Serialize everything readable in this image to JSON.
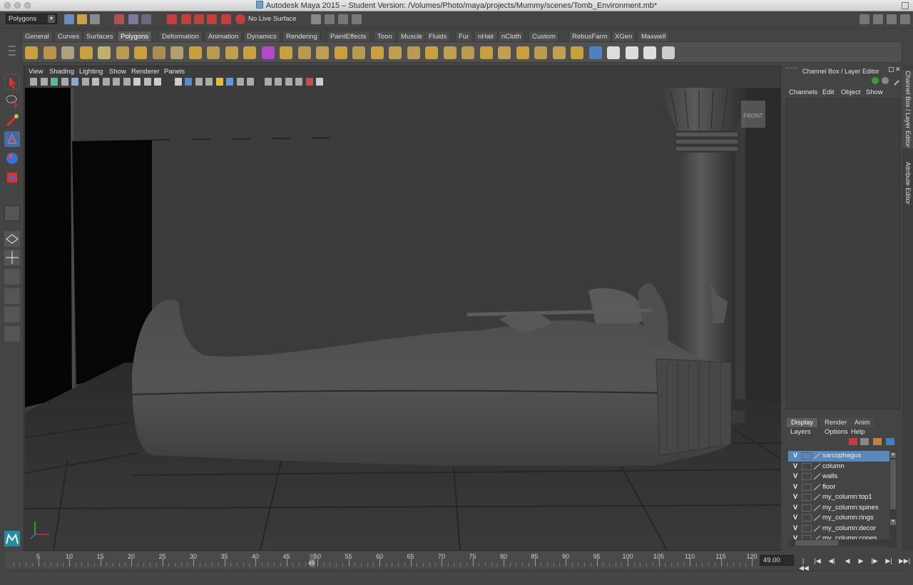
{
  "window": {
    "title": "Autodesk Maya 2015 – Student Version: /Volumes/Photo/maya/projects/Mummy/scenes/Tomb_Environment.mb*"
  },
  "status_line": {
    "menu_set": "Polygons",
    "live_surface": "No Live Surface"
  },
  "shelf_tabs": [
    "General",
    "Curves",
    "Surfaces",
    "Polygons",
    "Deformation",
    "Animation",
    "Dynamics",
    "Rendering",
    "PaintEffects",
    "Toon",
    "Muscle",
    "Fluids",
    "Fur",
    "nHair",
    "nCloth",
    "Custom",
    "RebusFarm",
    "XGen",
    "Maxwell"
  ],
  "shelf_active_tab": "Polygons",
  "viewport": {
    "menu": [
      "View",
      "Shading",
      "Lighting",
      "Show",
      "Renderer",
      "Panels"
    ],
    "view_cube_label": "FRONT"
  },
  "right_panel": {
    "title": "Channel Box / Layer Editor",
    "channel_menu": [
      "Channels",
      "Edit",
      "Object",
      "Show"
    ],
    "layer_tabs": [
      "Display",
      "Render",
      "Anim"
    ],
    "active_layer_tab": "Display",
    "layer_menu": [
      "Layers",
      "Options",
      "Help"
    ],
    "layers": [
      {
        "visible": "V",
        "name": "sarcophagus",
        "selected": true
      },
      {
        "visible": "V",
        "name": "column",
        "selected": false
      },
      {
        "visible": "V",
        "name": "walls",
        "selected": false
      },
      {
        "visible": "V",
        "name": "floor",
        "selected": false
      },
      {
        "visible": "V",
        "name": "my_column:top1",
        "selected": false
      },
      {
        "visible": "V",
        "name": "my_column:spines",
        "selected": false
      },
      {
        "visible": "V",
        "name": "my_column:rings",
        "selected": false
      },
      {
        "visible": "V",
        "name": "my_column:decor",
        "selected": false
      },
      {
        "visible": "V",
        "name": "my_column:cones",
        "selected": false
      }
    ]
  },
  "side_tabs": [
    "Channel Box / Layer Editor",
    "Attribute Editor"
  ],
  "time_slider": {
    "ticks": [
      "5",
      "10",
      "15",
      "20",
      "25",
      "30",
      "35",
      "40",
      "45",
      "50",
      "55",
      "60",
      "65",
      "70",
      "75",
      "80",
      "85",
      "90",
      "95",
      "100",
      "105",
      "110",
      "115",
      "120"
    ],
    "current_frame": "49.00",
    "playhead_label": "49"
  },
  "playback_buttons": [
    "go-to-start",
    "step-back-key",
    "step-back-frame",
    "play-backwards",
    "play-forwards",
    "step-forward-frame",
    "step-forward-key",
    "go-to-end"
  ],
  "colors": {
    "selection": "#5a88b8",
    "panel_bg": "#444444",
    "viewport_wall": "#3a3a3a"
  }
}
